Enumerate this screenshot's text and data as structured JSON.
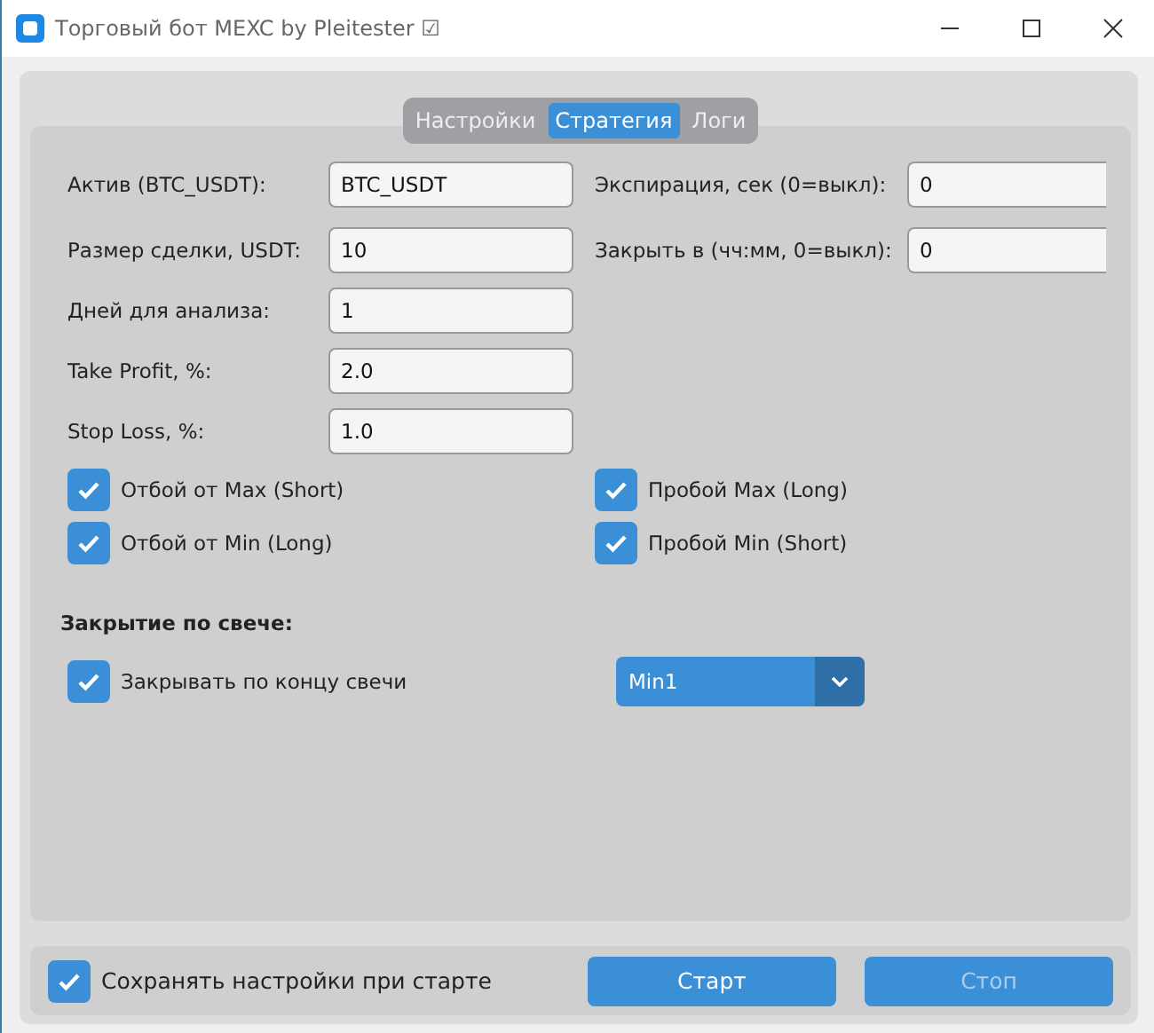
{
  "window": {
    "title": "Торговый бот MEXC by Pleitester ☑"
  },
  "tabs": [
    {
      "label": "Настройки",
      "selected": false
    },
    {
      "label": "Стратегия",
      "selected": true
    },
    {
      "label": "Логи",
      "selected": false
    }
  ],
  "fields": [
    {
      "label": "Актив (BTC_USDT):",
      "value": "BTC_USDT"
    },
    {
      "label": "Экспирация, сек (0=выкл):",
      "value": "0"
    },
    {
      "label": "Размер сделки, USDT:",
      "value": "10"
    },
    {
      "label": "Закрыть в (чч:мм, 0=выкл):",
      "value": "0"
    },
    {
      "label": "Дней для анализа:",
      "value": "1"
    },
    {
      "label": "Take Profit, %:",
      "value": "2.0"
    },
    {
      "label": "Stop Loss, %:",
      "value": "1.0"
    }
  ],
  "signals": [
    {
      "label": "Отбой от Max (Short)",
      "checked": true
    },
    {
      "label": "Пробой Max (Long)",
      "checked": true
    },
    {
      "label": "Отбой от Min (Long)",
      "checked": true
    },
    {
      "label": "Пробой Min (Short)",
      "checked": true
    }
  ],
  "candle_close": {
    "heading": "Закрытие по свече:",
    "option": {
      "label": "Закрывать по концу свечи",
      "checked": true
    },
    "timeframe": "Min1"
  },
  "footer": {
    "save_settings": {
      "label": "Сохранять настройки при старте",
      "checked": true
    },
    "buttons": [
      {
        "label": "Старт",
        "disabled": false
      },
      {
        "label": "Стоп",
        "disabled": true
      }
    ]
  }
}
